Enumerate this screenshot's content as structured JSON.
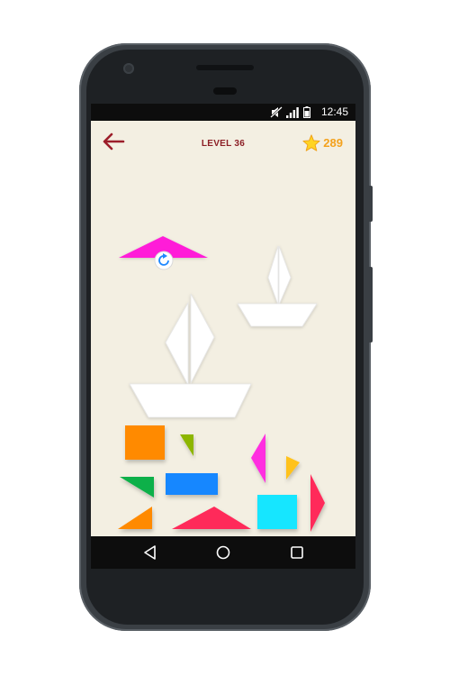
{
  "status_bar": {
    "time": "12:45",
    "icons": [
      "mute-icon",
      "signal-icon",
      "battery-icon"
    ]
  },
  "header": {
    "back_icon": "arrow-left-icon",
    "level_title": "LEVEL 36",
    "star_icon": "star-icon",
    "score": "289"
  },
  "board": {
    "targets": [
      "small-sailboat-silhouette",
      "large-sailboat-silhouette"
    ],
    "selected_piece": {
      "name": "magenta-large-triangle",
      "control": "rotate-icon"
    }
  },
  "tray": {
    "pieces": [
      {
        "name": "orange-square",
        "color": "#ff8a00"
      },
      {
        "name": "olive-small-triangle",
        "color": "#8db600"
      },
      {
        "name": "magenta-tall-triangle",
        "color": "#ff2ee0"
      },
      {
        "name": "yellow-small-triangle",
        "color": "#ffc21a"
      },
      {
        "name": "green-triangle",
        "color": "#10b04a"
      },
      {
        "name": "blue-rectangle",
        "color": "#1787ff"
      },
      {
        "name": "orange-triangle",
        "color": "#ff8a00"
      },
      {
        "name": "red-triangle",
        "color": "#ff2a5a"
      },
      {
        "name": "cyan-square",
        "color": "#14e6ff"
      },
      {
        "name": "pink-triangle",
        "color": "#ff2a5a"
      }
    ]
  },
  "navbar": {
    "back_icon": "nav-back-icon",
    "home_icon": "nav-home-icon",
    "recents_icon": "nav-recents-icon"
  },
  "colors": {
    "screen_bg": "#f3efe2",
    "level_title": "#8c1f26",
    "score": "#f3a21e",
    "selected_piece": "#ff1fd8"
  }
}
